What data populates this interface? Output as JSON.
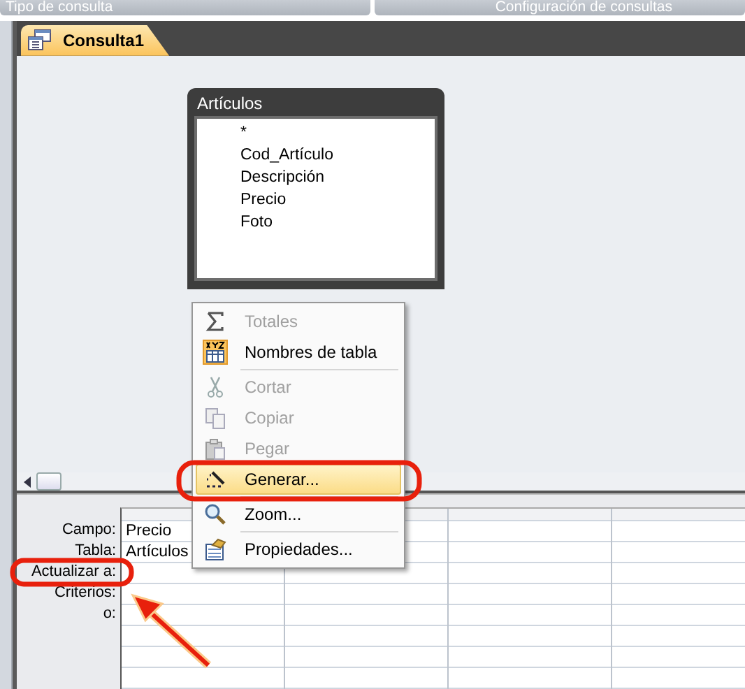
{
  "ribbon": {
    "groups": [
      {
        "label": "Tipo de consulta"
      },
      {
        "label": "Configuración de consultas"
      }
    ]
  },
  "tabs": [
    {
      "label": "Consulta1",
      "selected": true
    }
  ],
  "table_box": {
    "title": "Artículos",
    "fields": [
      "*",
      "Cod_Artículo",
      "Descripción",
      "Precio",
      "Foto"
    ]
  },
  "context_menu": {
    "items": [
      {
        "kind": "item",
        "label": "Totales",
        "disabled": true,
        "checked": false,
        "selected": false
      },
      {
        "kind": "item",
        "label": "Nombres de tabla",
        "disabled": false,
        "checked": true,
        "selected": false
      },
      {
        "kind": "separator"
      },
      {
        "kind": "item",
        "label": "Cortar",
        "disabled": true,
        "checked": false,
        "selected": false
      },
      {
        "kind": "item",
        "label": "Copiar",
        "disabled": true,
        "checked": false,
        "selected": false
      },
      {
        "kind": "item",
        "label": "Pegar",
        "disabled": true,
        "checked": false,
        "selected": false
      },
      {
        "kind": "item",
        "label": "Generar...",
        "disabled": false,
        "checked": false,
        "selected": true
      },
      {
        "kind": "separator"
      },
      {
        "kind": "item",
        "label": "Zoom...",
        "disabled": false,
        "checked": false,
        "selected": false
      },
      {
        "kind": "separator"
      },
      {
        "kind": "item",
        "label": "Propiedades...",
        "disabled": false,
        "checked": false,
        "selected": false
      }
    ]
  },
  "design_grid": {
    "row_labels": [
      "Campo:",
      "Tabla:",
      "Actualizar a:",
      "Criterios:",
      "o:"
    ],
    "columns": [
      {
        "cells": [
          "Precio",
          "Artículos"
        ]
      }
    ]
  }
}
